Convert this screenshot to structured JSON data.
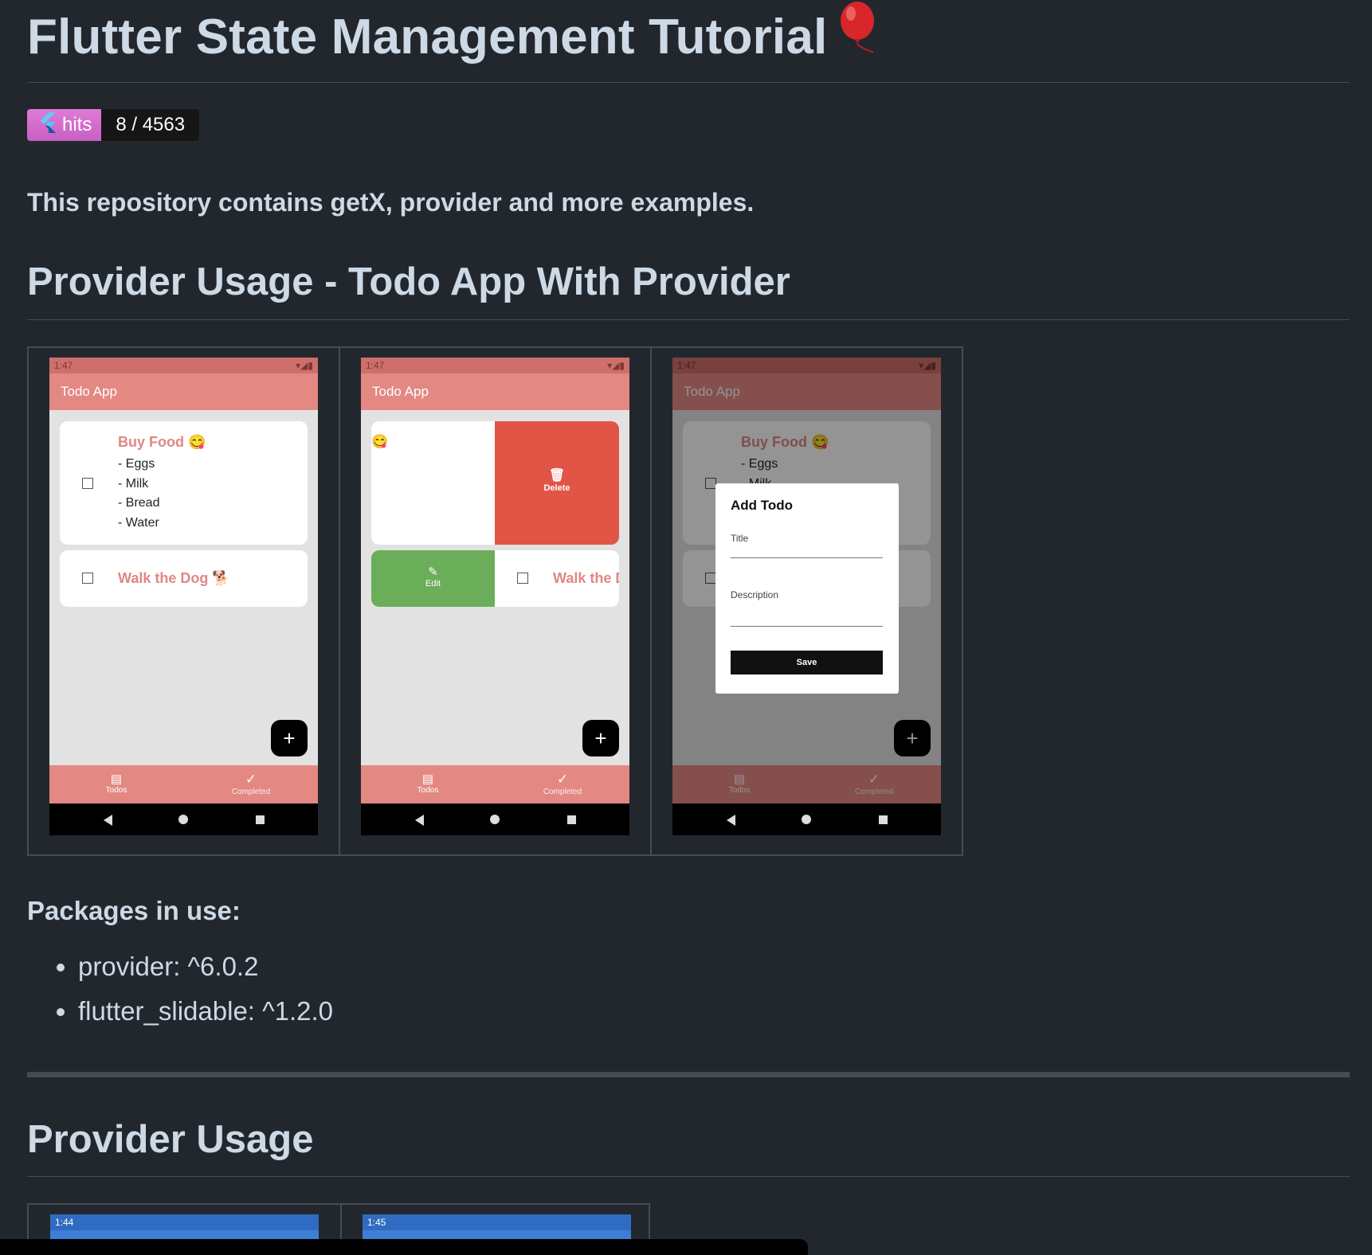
{
  "title": "Flutter State Management Tutorial",
  "title_icon": "balloon-icon",
  "badge": {
    "label": "hits",
    "value": "8 / 4563",
    "icon": "flutter-logo-icon"
  },
  "lead": "This repository contains getX, provider and more examples.",
  "section1": {
    "heading": "Provider Usage - Todo App With Provider"
  },
  "phones": {
    "time": "1:47",
    "app_title": "Todo App",
    "todo1": {
      "title": "Buy Food 😋",
      "desc": [
        "- Eggs",
        "- Milk",
        "- Bread",
        "- Water"
      ]
    },
    "todo2": {
      "title": "Walk the Dog 🐕",
      "title_cut": "Walk the D"
    },
    "delete_label": "Delete",
    "edit_label": "Edit",
    "emoji_only": "😋",
    "fab": "+",
    "tab_todos": "Todos",
    "tab_completed": "Completed",
    "dialog": {
      "title": "Add Todo",
      "title_label": "Title",
      "desc_label": "Description",
      "save": "Save"
    }
  },
  "packages": {
    "heading": "Packages in use:",
    "items": [
      "provider: ^6.0.2",
      "flutter_slidable: ^1.2.0"
    ]
  },
  "section2": {
    "heading": "Provider Usage"
  },
  "phones2": {
    "time1": "1:44",
    "time2": "1:45"
  },
  "colors": {
    "background": "#22272e",
    "heading": "#cdd9e5",
    "appbar": "#e38883",
    "delete": "#e05546",
    "edit": "#6bae5a"
  }
}
